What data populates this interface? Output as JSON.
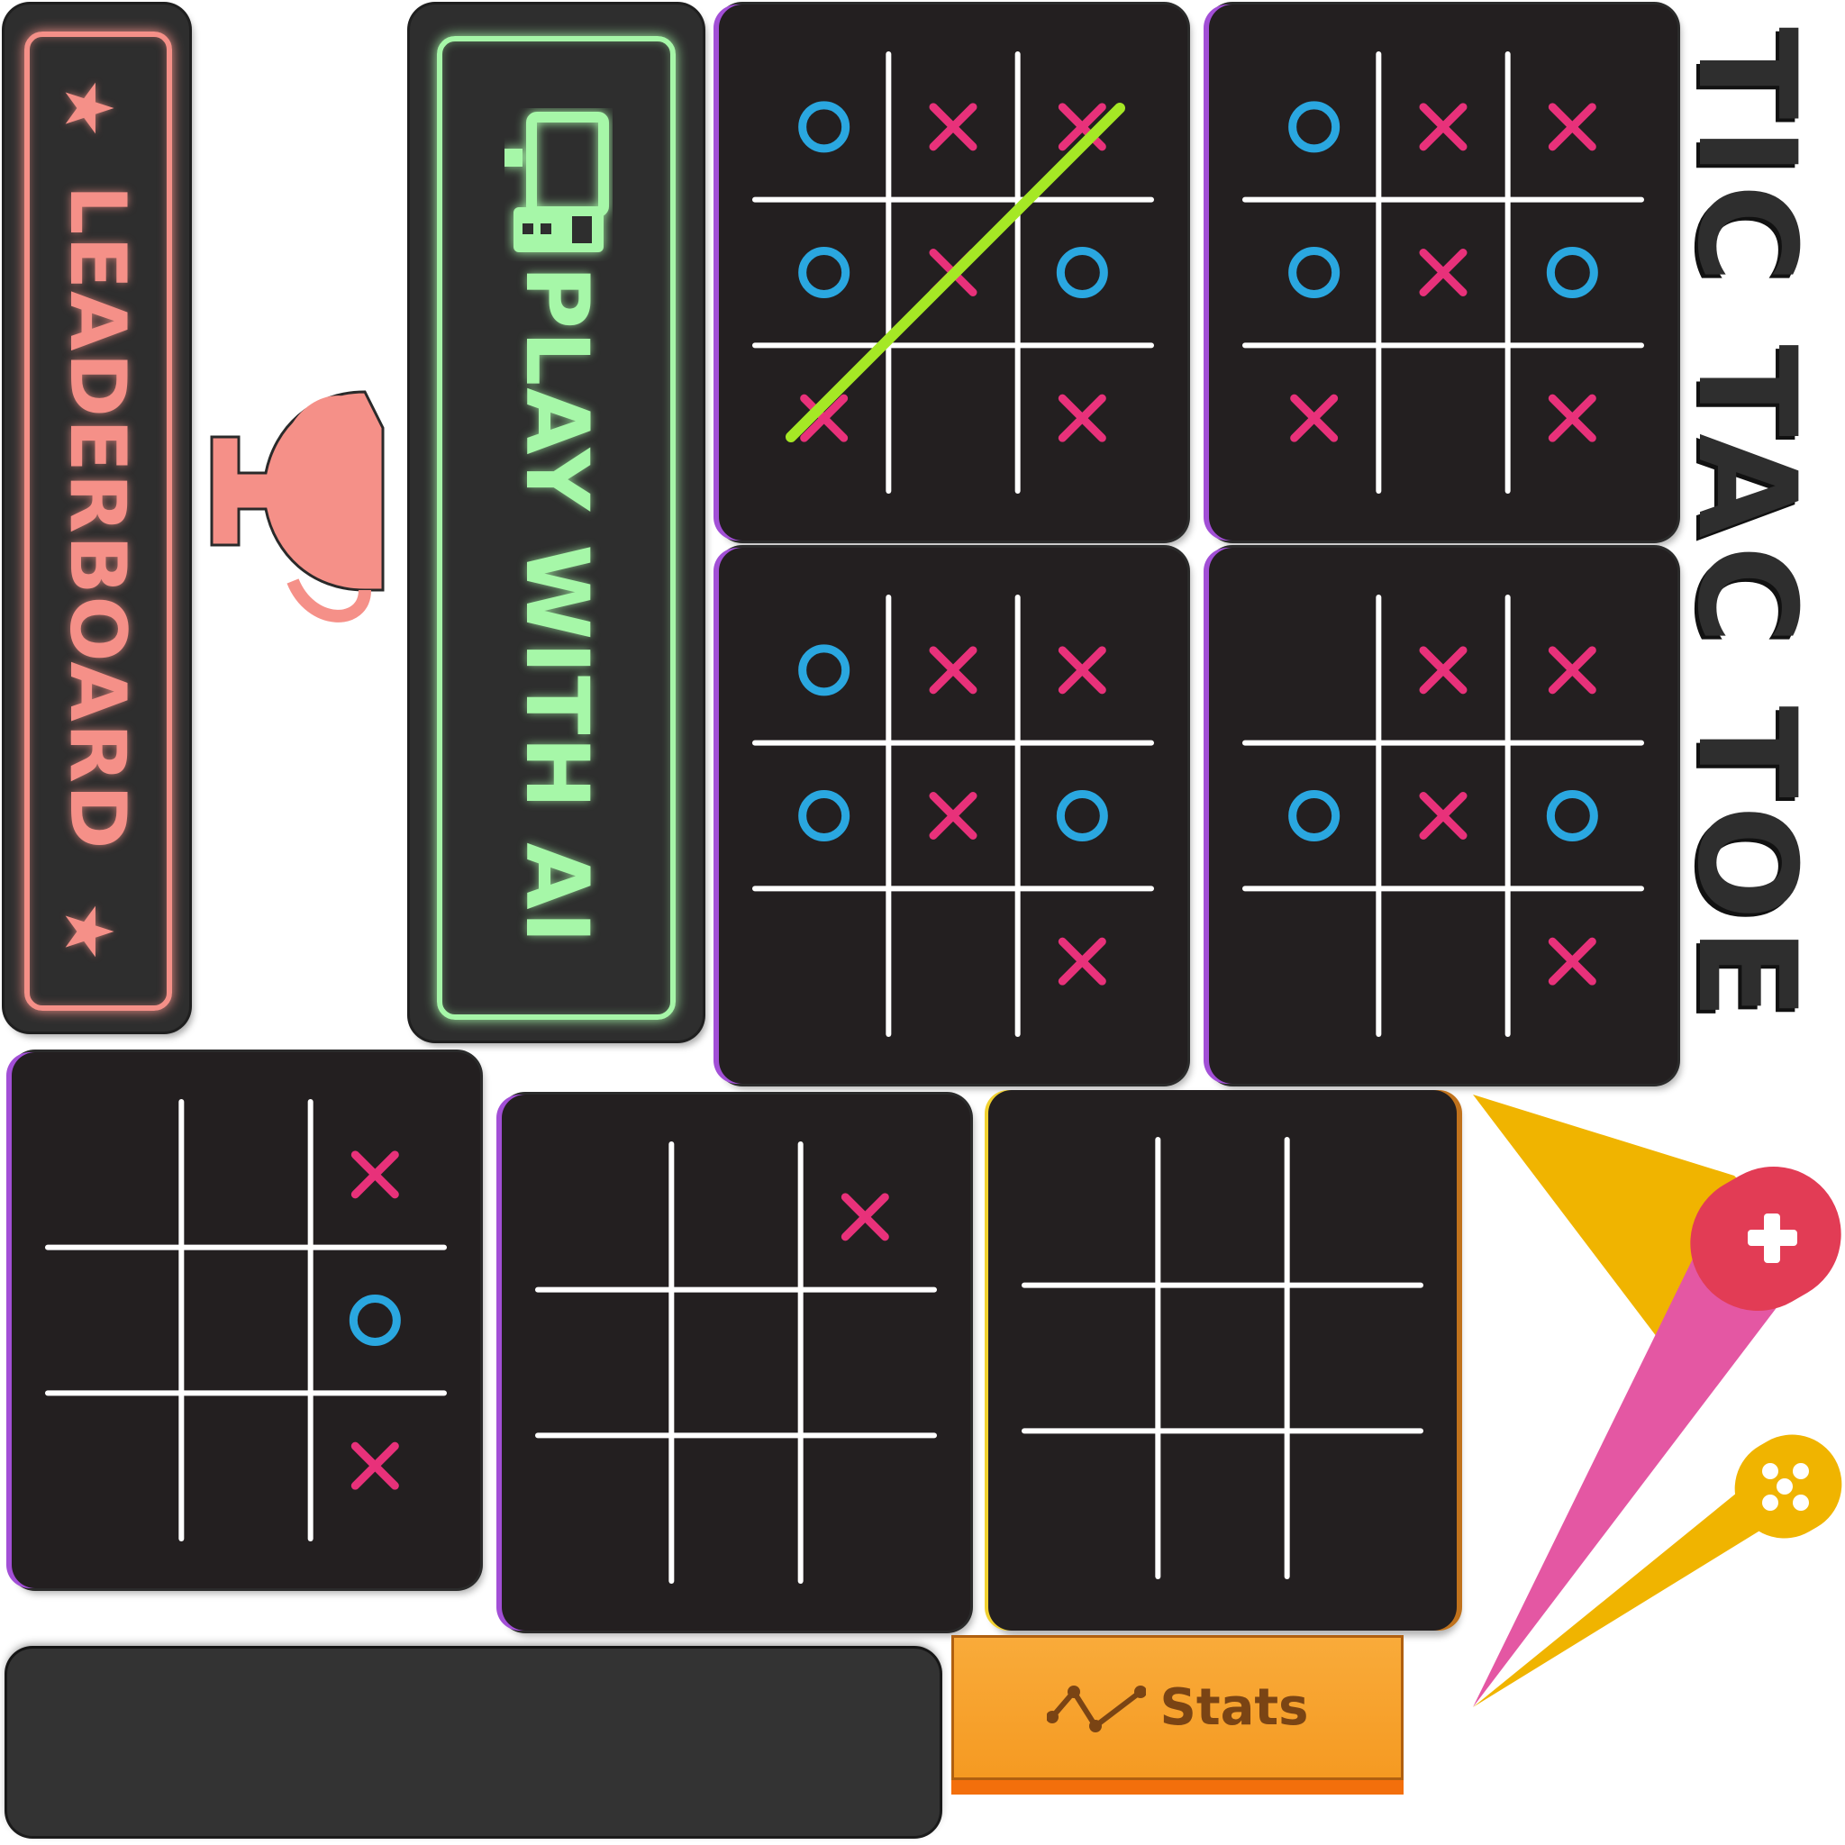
{
  "title": "TIC TAC TOE",
  "leaderboard": {
    "label": "LEADERBOARD",
    "star_icon": "★",
    "trophy_icon": "trophy-icon"
  },
  "play_ai": {
    "label": "PLAY WITH AI",
    "icon": "computer-icon"
  },
  "stats": {
    "label": "Stats",
    "icon": "line-chart-icon"
  },
  "colors": {
    "x": "#e8317a",
    "o": "#2aa7e0",
    "win_line": "#a5e825",
    "lb": "#f59088",
    "ai": "#a6f7a8",
    "stats": "#f7a02c"
  },
  "boards": [
    {
      "id": "board-1",
      "cells": [
        "O",
        "X",
        "X",
        "O",
        "X",
        "O",
        "X",
        "",
        ""
      ],
      "note_cells_3": "X at bottom-right",
      "win_line": true
    },
    {
      "id": "board-2",
      "cells": [
        "O",
        "X",
        "X",
        "O",
        "X",
        "O",
        "X",
        "",
        "X"
      ]
    },
    {
      "id": "board-3",
      "cells": [
        "O",
        "X",
        "X",
        "O",
        "X",
        "O",
        "",
        "",
        "X"
      ]
    },
    {
      "id": "board-4",
      "cells": [
        "",
        "X",
        "X",
        "O",
        "X",
        "O",
        "",
        "",
        "X"
      ]
    },
    {
      "id": "board-5",
      "cells": [
        "",
        "",
        "X",
        "",
        "",
        "O",
        "",
        "",
        "X"
      ]
    },
    {
      "id": "board-6",
      "cells": [
        "",
        "",
        "X",
        "",
        "",
        "",
        "",
        "",
        ""
      ]
    },
    {
      "id": "board-7",
      "cells": [
        "",
        "",
        "",
        "",
        "",
        "",
        "",
        "",
        ""
      ]
    }
  ],
  "mobile_logo": {
    "plus_icon": "plus-icon",
    "gamepad_icon": "gamepad-icon"
  }
}
